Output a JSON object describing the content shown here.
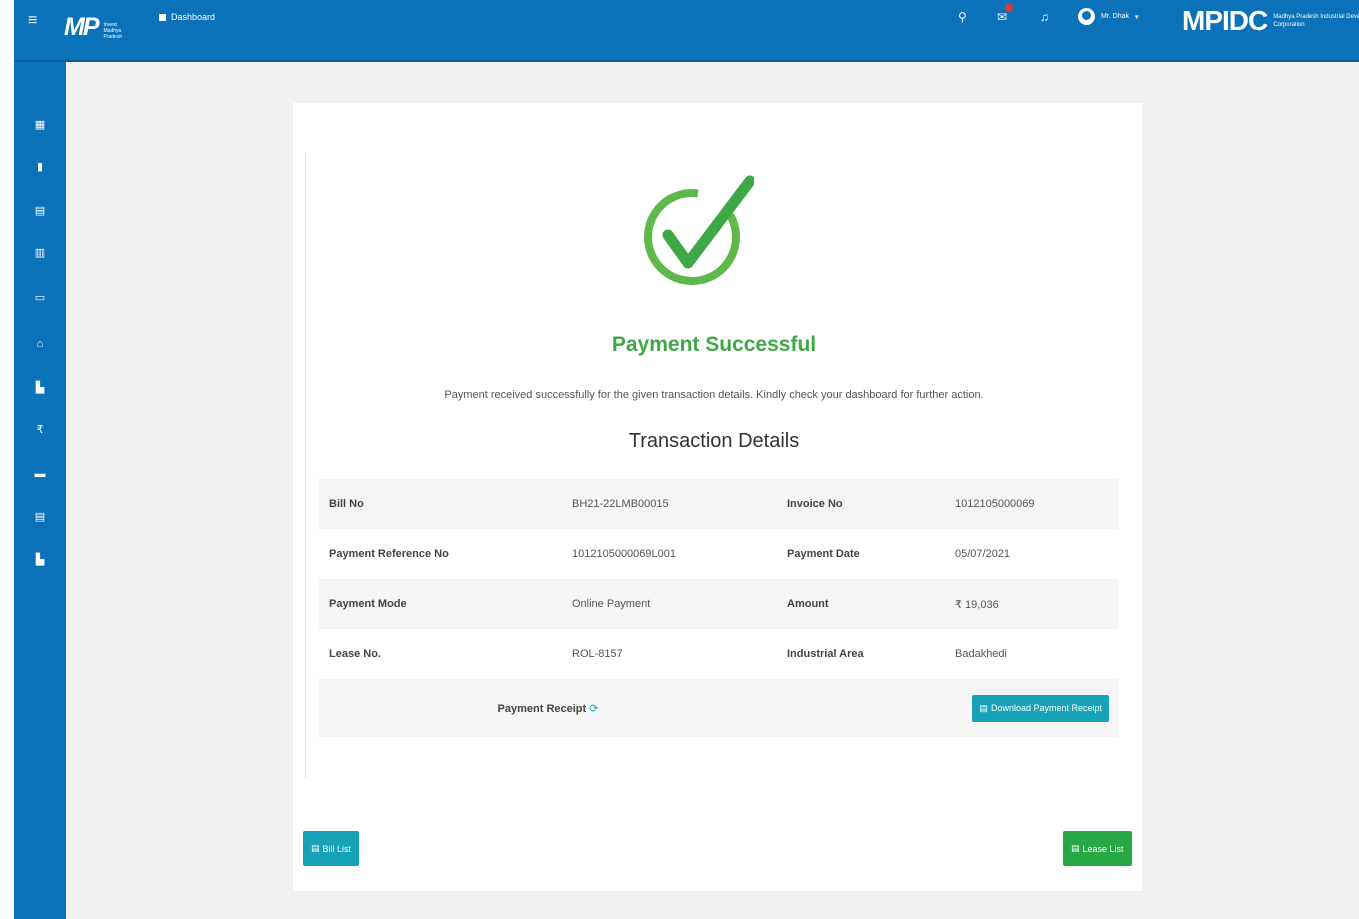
{
  "header": {
    "logo_text": "MP",
    "logo_sub": "Invest Madhya Pradesh",
    "nav_dashboard_label": "Dashboard",
    "user_name": "Mr. Dhak",
    "org_logo_text": "MPIDC",
    "org_logo_sub": "Madhya Pradesh Industrial Development Corporation",
    "mail_badge_color": "#e53935",
    "icons": [
      "menu-icon",
      "search-icon",
      "mail-icon",
      "bell-icon",
      "user-icon"
    ]
  },
  "sidebar": {
    "items": [
      {
        "icon": "grid-icon",
        "glyph": "▦"
      },
      {
        "icon": "bookmark-icon",
        "glyph": "▮"
      },
      {
        "icon": "document-icon",
        "glyph": "▤"
      },
      {
        "icon": "file-icon",
        "glyph": "▥"
      },
      {
        "icon": "card-icon",
        "glyph": "▭"
      },
      {
        "icon": "home-icon",
        "glyph": "⌂"
      },
      {
        "icon": "factory-icon",
        "glyph": "▙"
      },
      {
        "icon": "rupee-icon",
        "glyph": "₹"
      },
      {
        "icon": "wallet-icon",
        "glyph": "▬"
      },
      {
        "icon": "list-icon",
        "glyph": "▤"
      },
      {
        "icon": "industry-icon",
        "glyph": "▙"
      }
    ]
  },
  "main": {
    "success_title": "Payment Successful",
    "success_message": "Payment received successfully for the given transaction details. Kindly check your dashboard for further action.",
    "transaction_title": "Transaction Details",
    "rows": [
      {
        "label1": "Bill No",
        "value1": "BH21-22LMB00015",
        "label2": "Invoice No",
        "value2": "1012105000069"
      },
      {
        "label1": "Payment Reference No",
        "value1": "1012105000069L001",
        "label2": "Payment Date",
        "value2": "05/07/2021"
      },
      {
        "label1": "Payment Mode",
        "value1": "Online Payment",
        "label2": "Amount",
        "value2": "₹ 19,036"
      },
      {
        "label1": "Lease No.",
        "value1": "ROL-8157",
        "label2": "Industrial Area",
        "value2": "Badakhedi"
      }
    ],
    "receipt_label": "Payment Receipt",
    "download_button_label": "Download Payment Receipt",
    "bill_list_button_label": "Bill List",
    "lease_list_button_label": "Lease List",
    "colors": {
      "primary": "#0b71b8",
      "success": "#3fa846",
      "info_button": "#17a2b8",
      "success_button": "#28a745"
    }
  }
}
